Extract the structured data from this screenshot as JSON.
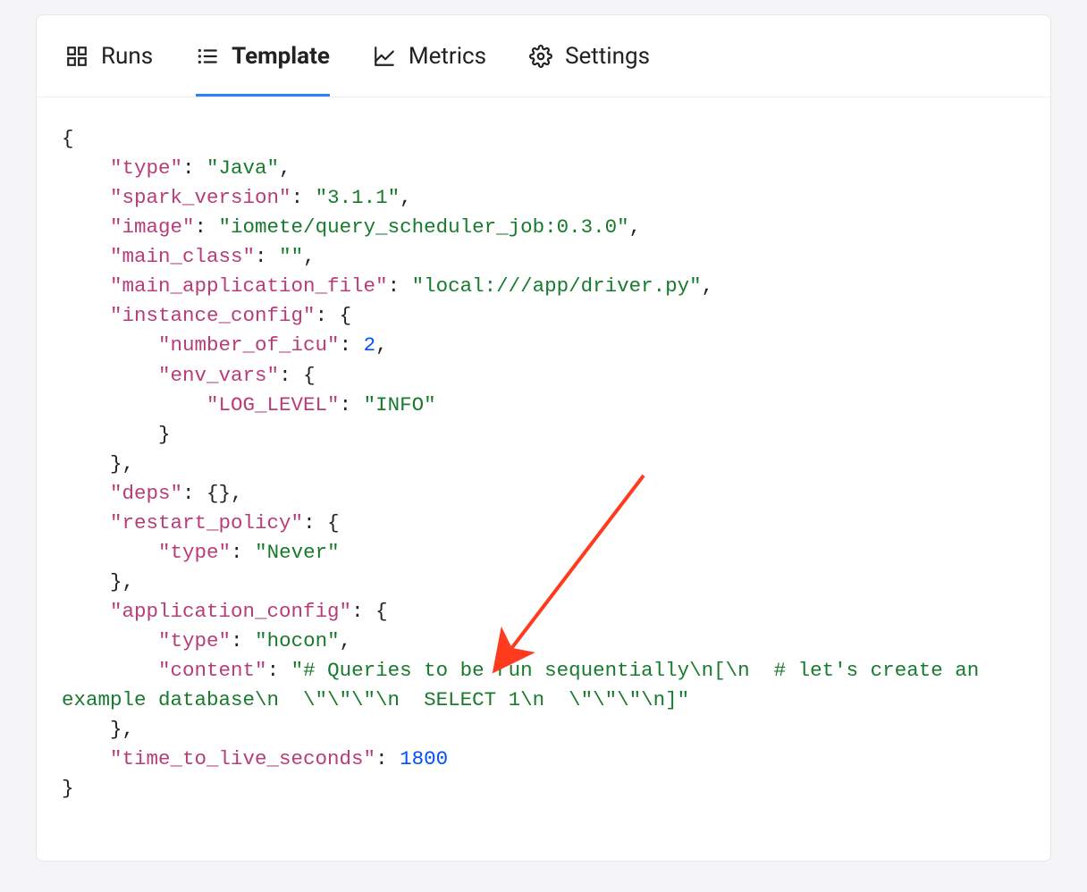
{
  "tabs": [
    {
      "label": "Runs",
      "icon": "grid-icon",
      "active": false
    },
    {
      "label": "Template",
      "icon": "list-icon",
      "active": true
    },
    {
      "label": "Metrics",
      "icon": "chart-icon",
      "active": false
    },
    {
      "label": "Settings",
      "icon": "gear-icon",
      "active": false
    }
  ],
  "template_json": {
    "type": "Java",
    "spark_version": "3.1.1",
    "image": "iomete/query_scheduler_job:0.3.0",
    "main_class": "",
    "main_application_file": "local:///app/driver.py",
    "instance_config": {
      "number_of_icu": 2,
      "env_vars": {
        "LOG_LEVEL": "INFO"
      }
    },
    "deps": {},
    "restart_policy": {
      "type": "Never"
    },
    "application_config": {
      "type": "hocon",
      "content": "# Queries to be run sequentially\\n[\\n  # let's create an example database\\n  \\\"\\\"\\\"\\n  SELECT 1\\n  \\\"\\\"\\\"\\n]"
    },
    "time_to_live_seconds": 1800
  },
  "ui_text": {
    "brace_open": "{",
    "brace_close": "}",
    "bracket_open": "[",
    "bracket_close": "]",
    "colon": ": ",
    "comma": ","
  }
}
